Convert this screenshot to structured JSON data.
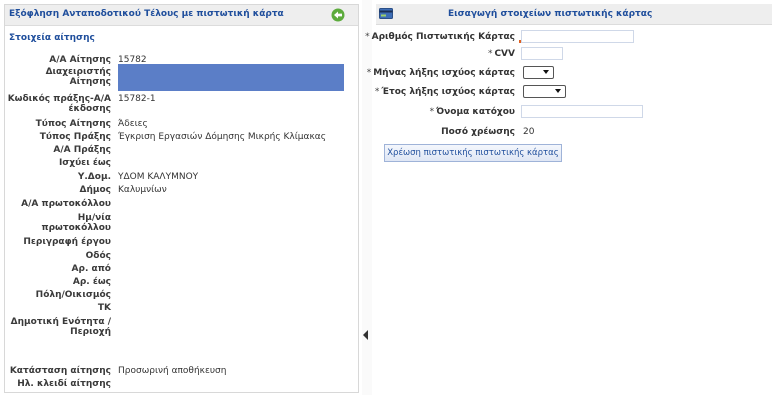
{
  "left_panel": {
    "title": "Εξόφληση Ανταποδοτικού Τέλους με πιστωτική κάρτα",
    "section_title": "Στοιχεία αίτησης",
    "fields": [
      {
        "label": "Α/Α Αίτησης",
        "value": "15782"
      },
      {
        "label": "Διαχειριστής Αίτησης",
        "value": ""
      },
      {
        "label": "Κωδικός πράξης-Α/Α έκδοσης",
        "value": "15782-1"
      },
      {
        "label": "Τύπος Αίτησης",
        "value": "Άδειες"
      },
      {
        "label": "Τύπος Πράξης",
        "value": "Έγκριση Εργασιών Δόμησης Μικρής Κλίμακας"
      },
      {
        "label": "Α/Α Πράξης",
        "value": ""
      },
      {
        "label": "Ισχύει έως",
        "value": ""
      },
      {
        "label": "Υ.Δομ.",
        "value": "ΥΔΟΜ ΚΑΛΥΜΝΟΥ"
      },
      {
        "label": "Δήμος",
        "value": "Καλυμνίων"
      },
      {
        "label": "Α/Α πρωτοκόλλου",
        "value": ""
      },
      {
        "label": "Ημ/νία πρωτοκόλλου",
        "value": ""
      },
      {
        "label": "Περιγραφή έργου",
        "value": ""
      },
      {
        "label": "Οδός",
        "value": ""
      },
      {
        "label": "Αρ. από",
        "value": ""
      },
      {
        "label": "Αρ. έως",
        "value": ""
      },
      {
        "label": "Πόλη/Οικισμός",
        "value": ""
      },
      {
        "label": "ΤΚ",
        "value": ""
      },
      {
        "label": "Δημοτική Ενότητα / Περιοχή",
        "value": ""
      },
      {
        "label": "Κατάσταση αίτησης",
        "value": "Προσωρινή αποθήκευση"
      },
      {
        "label": "Ηλ. κλειδί αίτησης",
        "value": ""
      }
    ]
  },
  "right_panel": {
    "title": "Εισαγωγή στοιχείων πιστωτικής κάρτας",
    "required_mark": "*",
    "card_number_label": "Αριθμός Πιστωτικής Κάρτας",
    "cvv_label": "CVV",
    "exp_month_label": "Μήνας λήξης ισχύος κάρτας",
    "exp_year_label": "Έτος λήξης ισχύος κάρτας",
    "holder_label": "Όνομα κατόχου",
    "amount_label": "Ποσό χρέωσης",
    "amount_value": "20",
    "charge_button": "Χρέωση πιστωτικής πιστωτικής κάρτας"
  },
  "colors": {
    "accent": "#1f4e9c",
    "masked_field": "#5b7ec7",
    "header_bg": "#eeeeee",
    "icon_green": "#5cab3c"
  },
  "icons": {
    "collapse": "circle-arrow-left-icon",
    "card": "credit-card-icon",
    "splitter": "triangle-left-icon"
  }
}
